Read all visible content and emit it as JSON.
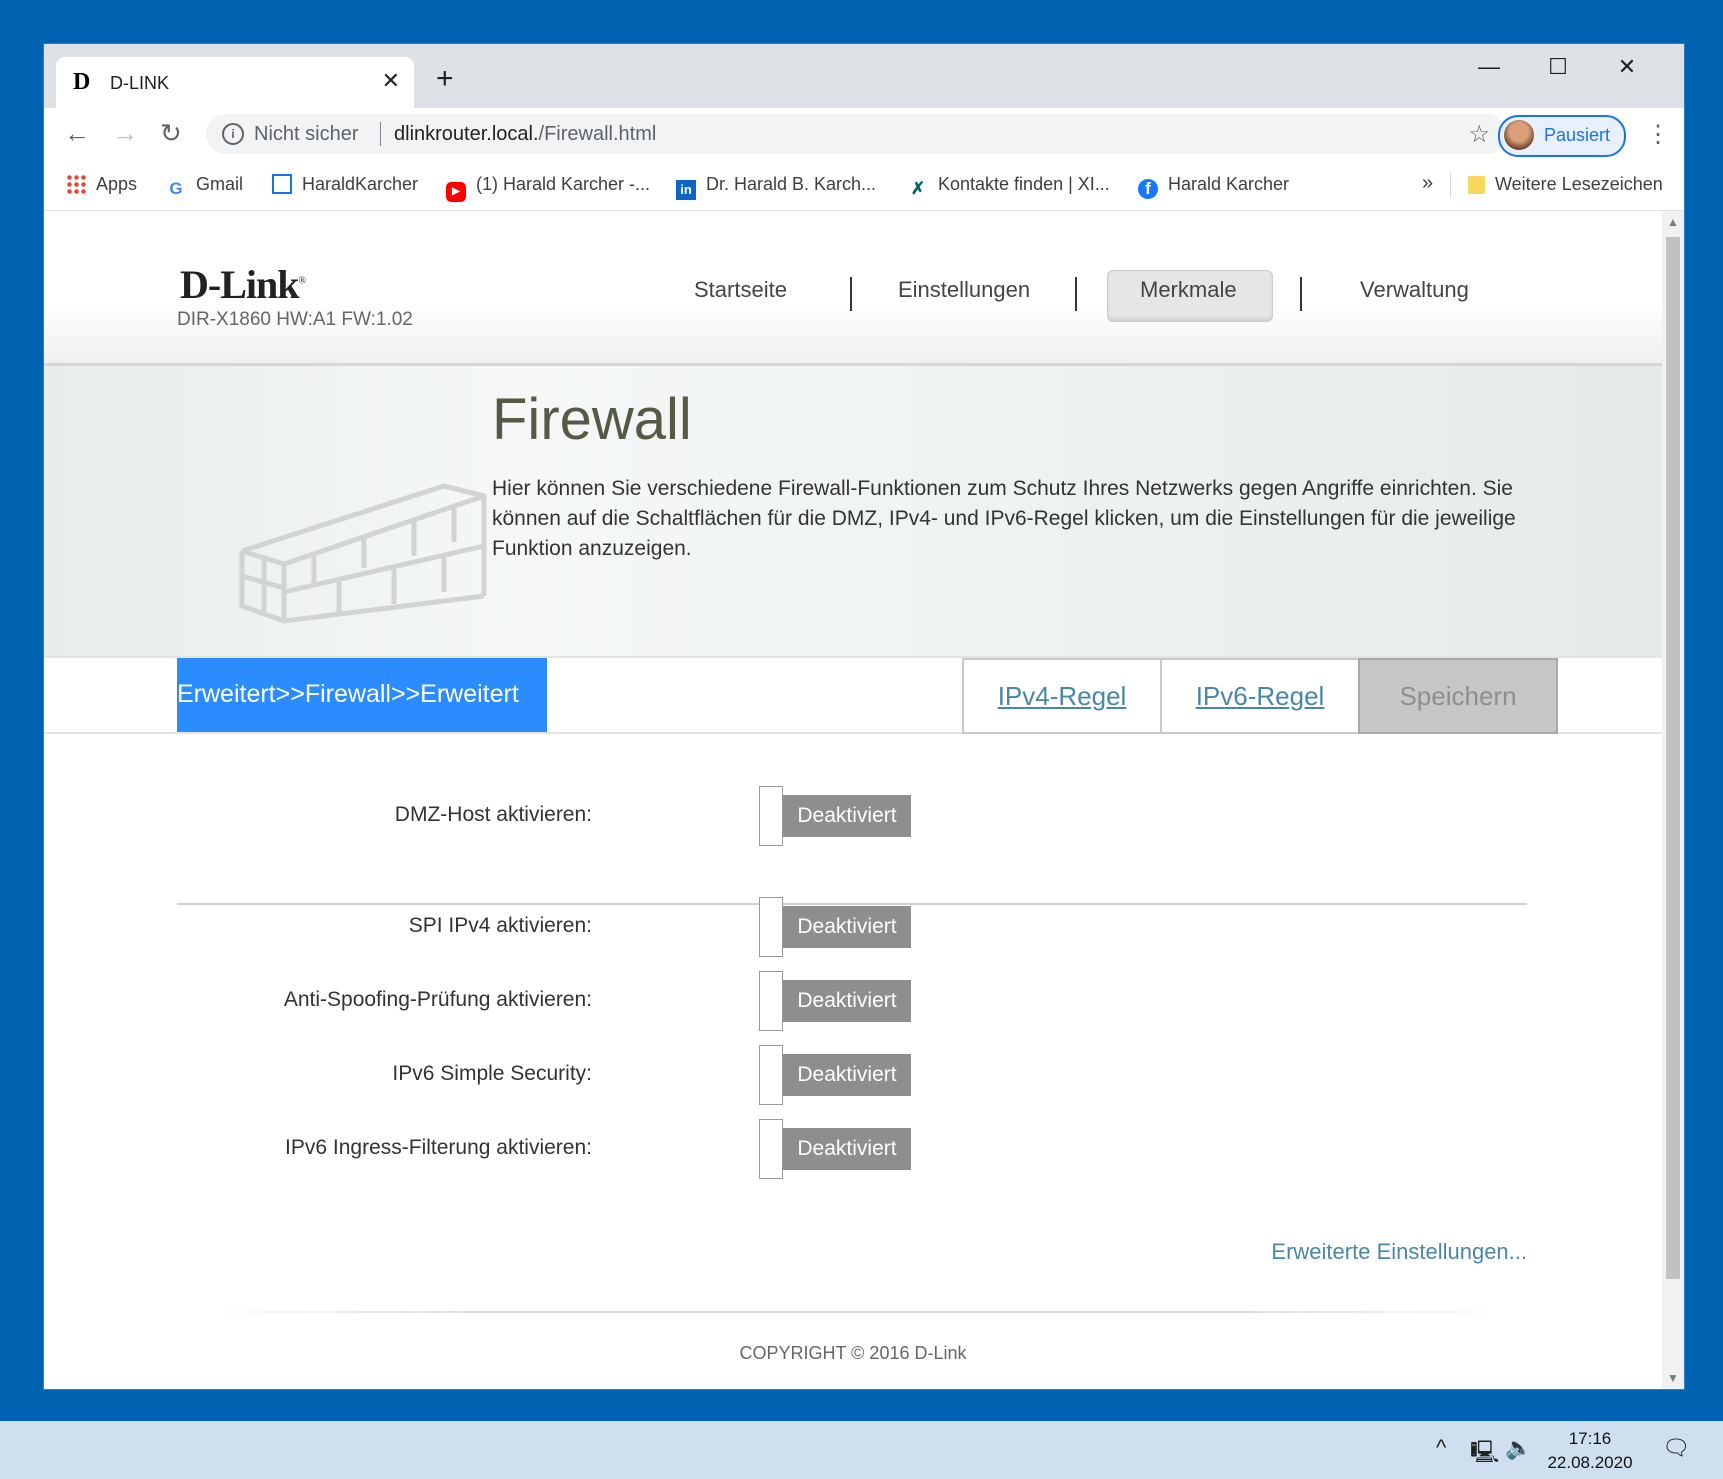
{
  "browser": {
    "tab_title": "D-LINK",
    "tab_favicon": "D",
    "new_tab": "+",
    "window_controls": {
      "minimize": "—",
      "maximize": "☐",
      "close": "✕"
    },
    "security_label": "Nicht sicher",
    "url_host": "dlinkrouter.local.",
    "url_path": "/Firewall.html",
    "profile_label": "Pausiert",
    "bookmarks": [
      {
        "label": "Apps",
        "icon": "apps-grid-icon"
      },
      {
        "label": "Gmail",
        "icon": "google-icon"
      },
      {
        "label": "HaraldKarcher",
        "icon": "site-icon"
      },
      {
        "label": "(1) Harald Karcher -...",
        "icon": "youtube-icon"
      },
      {
        "label": "Dr. Harald B. Karch...",
        "icon": "linkedin-icon"
      },
      {
        "label": "Kontakte finden | XI...",
        "icon": "xing-icon"
      },
      {
        "label": "Harald Karcher",
        "icon": "facebook-icon"
      }
    ],
    "bookmarks_more": "»",
    "other_bookmarks": "Weitere Lesezeichen"
  },
  "router": {
    "logo": "D-Link",
    "model": "DIR-X1860 HW:A1 FW:1.02",
    "nav": [
      "Startseite",
      "Einstellungen",
      "Merkmale",
      "Verwaltung"
    ],
    "nav_active": "Merkmale"
  },
  "page": {
    "title": "Firewall",
    "description": "Hier können Sie verschiedene Firewall-Funktionen zum Schutz Ihres Netzwerks gegen Angriffe einrichten. Sie können auf die Schaltflächen für die DMZ, IPv4- und IPv6-Regel klicken, um die Einstellungen für die jeweilige Funktion anzuzeigen.",
    "breadcrumb": "Erweitert>>Firewall>>Erweitert",
    "buttons": {
      "ipv4": "IPv4-Regel",
      "ipv6": "IPv6-Regel",
      "save": "Speichern"
    },
    "settings": [
      {
        "label": "DMZ-Host aktivieren:",
        "state": "Deaktiviert"
      },
      {
        "label": "SPI IPv4 aktivieren:",
        "state": "Deaktiviert"
      },
      {
        "label": "Anti-Spoofing-Prüfung aktivieren:",
        "state": "Deaktiviert"
      },
      {
        "label": "IPv6 Simple Security:",
        "state": "Deaktiviert"
      },
      {
        "label": "IPv6 Ingress-Filterung aktivieren:",
        "state": "Deaktiviert"
      }
    ],
    "advanced_link": "Erweiterte Einstellungen...",
    "copyright": "COPYRIGHT © 2016 D-Link"
  },
  "taskbar": {
    "time": "17:16",
    "date": "22.08.2020"
  },
  "colors": {
    "accent": "#2b8cff",
    "desktop": "#0063b1",
    "toggle_off": "#8e8e8e"
  }
}
